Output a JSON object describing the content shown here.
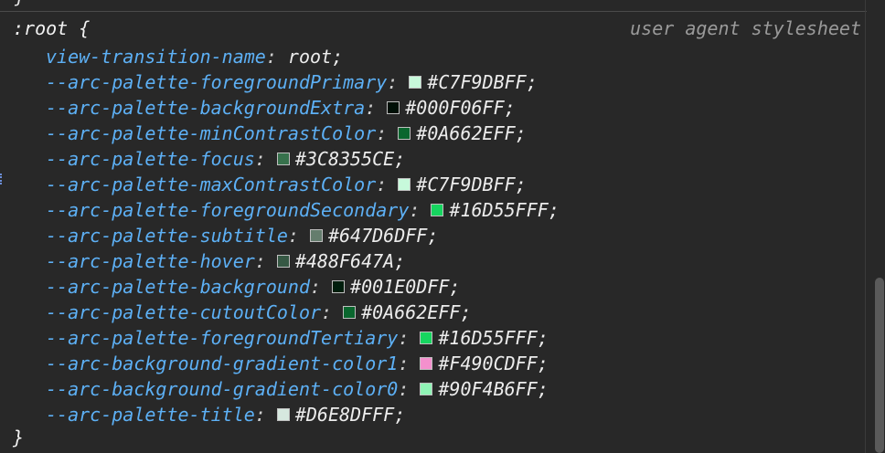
{
  "rule": {
    "selector_text": ":root {",
    "source": "user agent stylesheet",
    "closing": "}",
    "top_closing": "}"
  },
  "declarations": [
    {
      "name": "view-transition-name",
      "value": "root",
      "swatch": null
    },
    {
      "name": "--arc-palette-foregroundPrimary",
      "value": "#C7F9DBFF",
      "swatch": "#C7F9DB"
    },
    {
      "name": "--arc-palette-backgroundExtra",
      "value": "#000F06FF",
      "swatch": "#000F06"
    },
    {
      "name": "--arc-palette-minContrastColor",
      "value": "#0A662EFF",
      "swatch": "#0A662E"
    },
    {
      "name": "--arc-palette-focus",
      "value": "#3C8355CE",
      "swatch": "#3C8355CE"
    },
    {
      "name": "--arc-palette-maxContrastColor",
      "value": "#C7F9DBFF",
      "swatch": "#C7F9DB"
    },
    {
      "name": "--arc-palette-foregroundSecondary",
      "value": "#16D55FFF",
      "swatch": "#16D55F"
    },
    {
      "name": "--arc-palette-subtitle",
      "value": "#647D6DFF",
      "swatch": "#647D6D"
    },
    {
      "name": "--arc-palette-hover",
      "value": "#488F647A",
      "swatch": "#488F647A"
    },
    {
      "name": "--arc-palette-background",
      "value": "#001E0DFF",
      "swatch": "#001E0D"
    },
    {
      "name": "--arc-palette-cutoutColor",
      "value": "#0A662EFF",
      "swatch": "#0A662E"
    },
    {
      "name": "--arc-palette-foregroundTertiary",
      "value": "#16D55FFF",
      "swatch": "#16D55F"
    },
    {
      "name": "--arc-background-gradient-color1",
      "value": "#F490CDFF",
      "swatch": "#F490CD"
    },
    {
      "name": "--arc-background-gradient-color0",
      "value": "#90F4B6FF",
      "swatch": "#90F4B6"
    },
    {
      "name": "--arc-palette-title",
      "value": "#D6E8DFFF",
      "swatch": "#D6E8DF"
    }
  ]
}
